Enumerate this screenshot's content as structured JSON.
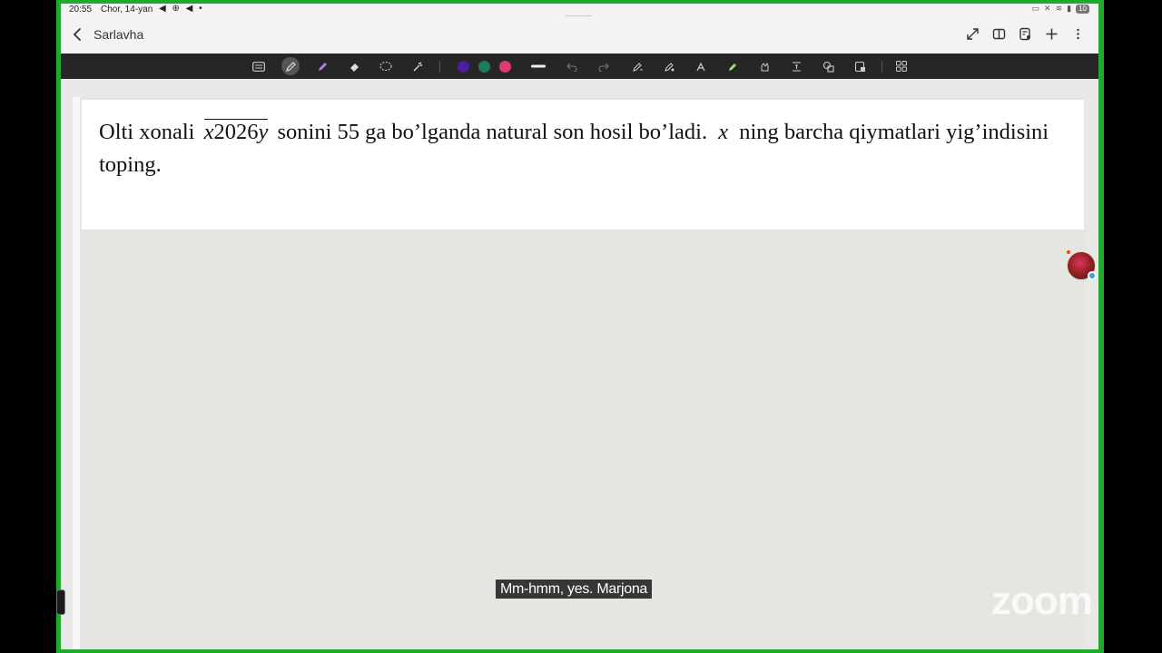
{
  "status_bar": {
    "time": "20:55",
    "date": "Chor, 14-yan",
    "notifications": "◀ ⊕ ◀ •",
    "battery": "10"
  },
  "header": {
    "title": "Sarlavha"
  },
  "toolbar": {
    "colors": [
      "#4b1fa0",
      "#1f7a5e",
      "#e03a6e"
    ]
  },
  "problem": {
    "text_before": "Olti xonali",
    "overline_var_x": "x",
    "overline_digits": "2026",
    "overline_var_y": "y",
    "text_middle": "sonini 55 ga bo’lganda natural son hosil bo’ladi.",
    "var_x": "x",
    "text_after": "ning barcha qiymatlari yig’indisini toping."
  },
  "caption": {
    "text": "Mm-hmm, yes. Marjona"
  },
  "watermark": {
    "text": "zoom"
  }
}
